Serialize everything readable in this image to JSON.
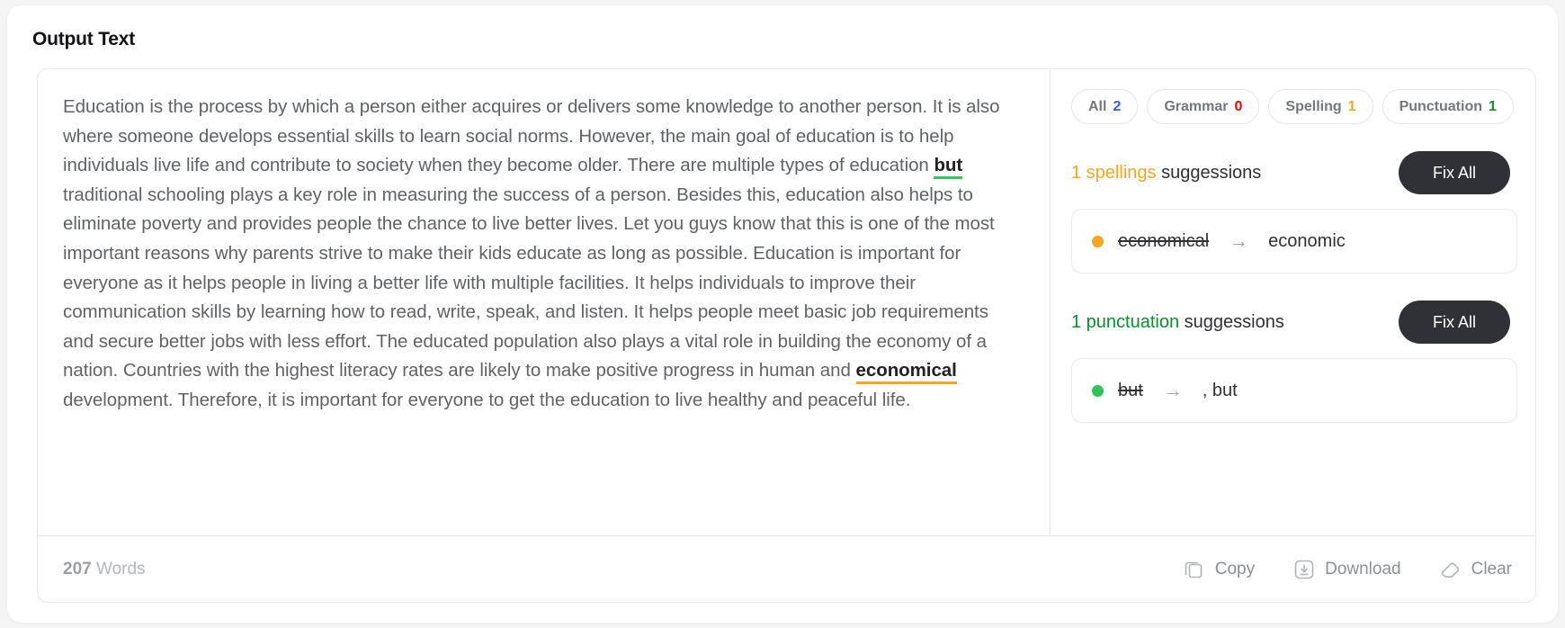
{
  "panel": {
    "title": "Output Text"
  },
  "editor": {
    "text_parts": [
      {
        "type": "text",
        "value": "Education is the process by which a person either acquires or delivers some knowledge to another person. It is also where someone develops essential skills to learn social norms. However, the main goal of education is to help individuals live life and contribute to society when they become older. There are multiple types of education "
      },
      {
        "type": "mark",
        "value": "but",
        "style": "green"
      },
      {
        "type": "text",
        "value": " traditional schooling plays a key role in measuring the success of a person. Besides this, education also helps to eliminate poverty and provides people the chance to live better lives. Let you guys know that this is one of the most important reasons why parents strive to make their kids educate as long as possible. Education is important for everyone as it helps people in living a better life with multiple facilities. It helps individuals to improve their communication skills by learning how to read, write, speak, and listen. It helps people meet basic job requirements and secure better jobs with less effort. The educated population also plays a vital role in building the economy of a nation. Countries with the highest literacy rates are likely to make positive progress in human and "
      },
      {
        "type": "mark",
        "value": "economical",
        "style": "orange"
      },
      {
        "type": "text",
        "value": " development. Therefore, it is important for everyone to get the education to live healthy and peaceful life."
      }
    ]
  },
  "tabs": [
    {
      "key": "all",
      "label": "All",
      "count": "2",
      "count_color": "#3b5bdb"
    },
    {
      "key": "grammar",
      "label": "Grammar",
      "count": "0",
      "count_color": "#ff0000"
    },
    {
      "key": "spelling",
      "label": "Spelling",
      "count": "1",
      "count_color": "#f5a623"
    },
    {
      "key": "punctuation",
      "label": "Punctuation",
      "count": "1",
      "count_color": "#0a8f2e"
    }
  ],
  "suggestion_groups": [
    {
      "key": "spelling",
      "count_text": "1 spellings",
      "suffix_text": " suggessions",
      "accent": "#f5a623",
      "fix_all_label": "Fix All",
      "items": [
        {
          "old": "economical",
          "arrow": "→",
          "new": "economic",
          "dot_color": "#f5a623"
        }
      ]
    },
    {
      "key": "punctuation",
      "count_text": "1 punctuation",
      "suffix_text": " suggessions",
      "accent": "#0a8f2e",
      "fix_all_label": "Fix All",
      "items": [
        {
          "old": "but",
          "arrow": "→",
          "new": ", but",
          "dot_color": "#2fc35a"
        }
      ]
    }
  ],
  "footer": {
    "word_count_number": "207",
    "word_count_label": " Words",
    "actions": [
      {
        "key": "copy",
        "label": "Copy",
        "icon": "copy-icon"
      },
      {
        "key": "download",
        "label": "Download",
        "icon": "download-icon"
      },
      {
        "key": "clear",
        "label": "Clear",
        "icon": "eraser-icon"
      }
    ]
  }
}
